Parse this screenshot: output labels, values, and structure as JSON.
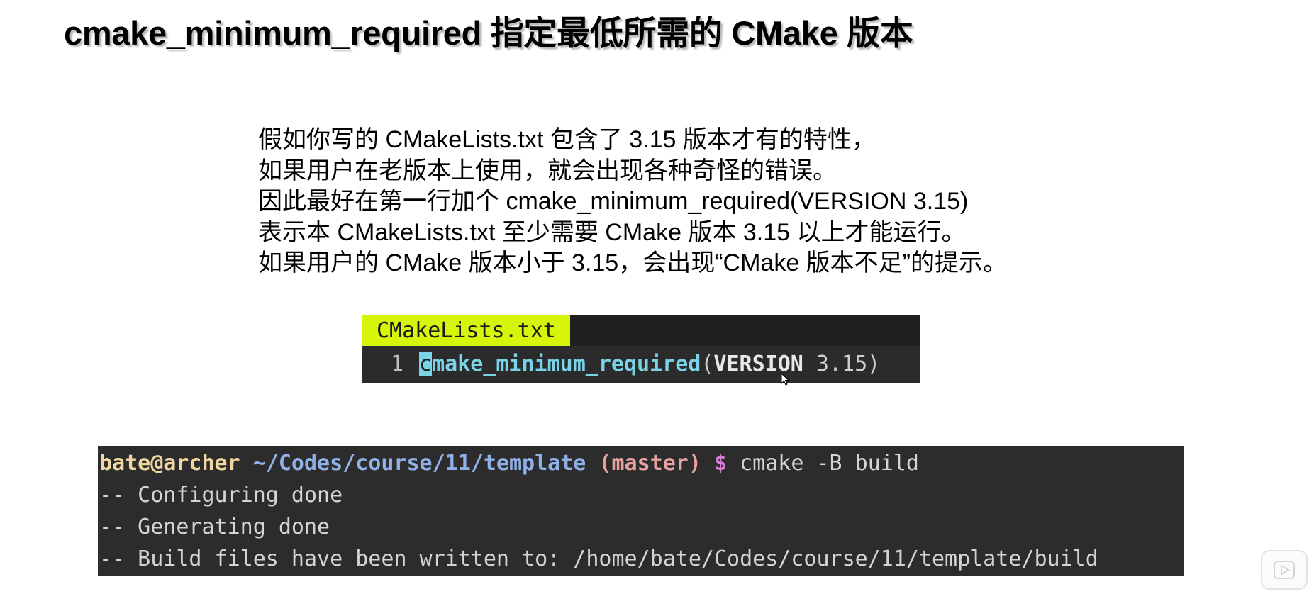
{
  "slide": {
    "title": "cmake_minimum_required 指定最低所需的 CMake 版本",
    "description_lines": [
      "假如你写的 CMakeLists.txt 包含了 3.15 版本才有的特性，",
      "如果用户在老版本上使用，就会出现各种奇怪的错误。",
      "因此最好在第一行加个 cmake_minimum_required(VERSION 3.15)",
      "表示本 CMakeLists.txt 至少需要 CMake 版本 3.15 以上才能运行。",
      "如果用户的 CMake 版本小于 3.15，会出现“CMake 版本不足”的提示。"
    ]
  },
  "editor": {
    "tab_label": "CMakeLists.txt",
    "line_number": "1",
    "code": {
      "cursor_char": "c",
      "function_rest": "make_minimum_required",
      "open_paren": "(",
      "keyword": "VERSION",
      "value": " 3.15",
      "close_paren": ")"
    },
    "colors": {
      "tab_bg": "#d7f50b",
      "function": "#7ad3e6",
      "background": "#2b2b2b"
    }
  },
  "terminal": {
    "prompt": {
      "user_host": "bate@archer",
      "path": "~/Codes/course/11/template",
      "branch": "(master)",
      "symbol": "$",
      "command": "cmake -B build"
    },
    "output_lines": [
      "-- Configuring done",
      "-- Generating done",
      "-- Build files have been written to: /home/bate/Codes/course/11/template/build"
    ],
    "colors": {
      "user": "#f0d7a0",
      "path": "#8fb1e8",
      "branch": "#e8a0a0",
      "dollar": "#d77cd6",
      "background": "#2c2c2c"
    }
  },
  "icons": {
    "play_badge": "play-icon"
  }
}
